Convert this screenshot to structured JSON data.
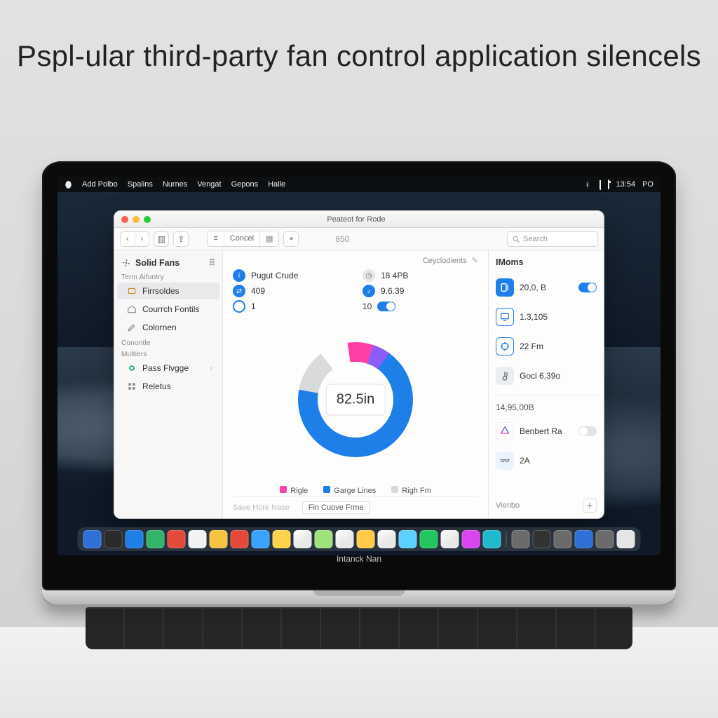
{
  "headline": "Pspl-ular third-party fan control application silencels",
  "menubar": {
    "items": [
      "Add Polbo",
      "Spalins",
      "Nurnes",
      "Vengat",
      "Gepons",
      "Halle"
    ],
    "clock": "13:54",
    "suffix": "PO"
  },
  "window": {
    "title": "Peateot for Rode",
    "toolbar": {
      "cancel": "Concel",
      "small_num": "850",
      "search_placeholder": "Search"
    },
    "sidebar": {
      "title": "Solid Fans",
      "sections": [
        {
          "label": "Term Aifuntry",
          "items": [
            {
              "label": "Firrsoldes",
              "icon": "box"
            },
            {
              "label": "Courrch Fontils",
              "icon": "home"
            },
            {
              "label": "Colornen",
              "icon": "pen"
            }
          ]
        },
        {
          "label": "Conontle",
          "items": []
        },
        {
          "label": "Multiers",
          "items": [
            {
              "label": "Pass Flvgge",
              "icon": "ring",
              "chevron": true
            },
            {
              "label": "Reletus",
              "icon": "grid"
            }
          ]
        }
      ]
    },
    "breadcrumb": "Ceyclodients",
    "stats": {
      "left": [
        {
          "icon": "info",
          "label": "Pugut Crude",
          "value": ""
        },
        {
          "icon": "swap",
          "label": "",
          "value": "409"
        },
        {
          "icon": "dot",
          "label": "",
          "value": "1"
        }
      ],
      "right": [
        {
          "icon": "clock",
          "label": "",
          "value": "18 4PB"
        },
        {
          "icon": "note",
          "label": "",
          "value": "9.6.39"
        },
        {
          "icon": "toggle",
          "label": "",
          "value": "10"
        }
      ]
    },
    "chart_data": {
      "type": "pie",
      "title": "",
      "center_label": "82.5in",
      "series": [
        {
          "name": "Rigle",
          "value": 8,
          "color": "#ff3fa8"
        },
        {
          "name": "Garge Lines",
          "value": 72,
          "color": "#1f7fe8"
        },
        {
          "name": "Righ Fm",
          "value": 12,
          "color": "#d9dadc"
        },
        {
          "name": "gap",
          "value": 8,
          "color": "#ffffff"
        }
      ]
    },
    "footer": {
      "save": "Save Hore Nase",
      "dropdown": "Fin Cuove Frme"
    },
    "right_panel": {
      "title": "IMoms",
      "rows": [
        {
          "icon": "gauge",
          "style": "blue",
          "value": "20,0, B",
          "toggle": true
        },
        {
          "icon": "monitor",
          "style": "out",
          "value": "1.3,105"
        },
        {
          "icon": "target",
          "style": "out",
          "value": "22 Fm"
        },
        {
          "icon": "thermo",
          "style": "gray",
          "value": "Gocl 6,39o"
        }
      ],
      "subtotal": "14,95,00B",
      "extras": [
        {
          "icon": "triangle",
          "label": "Benbert Ra",
          "toggle": false
        },
        {
          "icon": "goggles",
          "label": "2A"
        }
      ],
      "footer_label": "Vienbo"
    }
  },
  "hinge_label": "Intanck Nan",
  "dock_colors": [
    "#2f6fd6",
    "#2b2b2b",
    "#1f7fe8",
    "#34b36a",
    "#e24b3b",
    "#f2f2f2",
    "#f6c343",
    "#e24b3b",
    "#3aa3ff",
    "#ffd24a",
    "#ffffff",
    "#9fe17a",
    "#ffffff",
    "#ffc94a",
    "#ffffff",
    "#5ad1ff",
    "#22c55e",
    "#ffffff",
    "#d946ef",
    "#22b8cf",
    "#6b6b6b",
    "#333333",
    "#6b6b6b",
    "#2f6fd6",
    "#6b6b6b",
    "#e5e5e5"
  ]
}
